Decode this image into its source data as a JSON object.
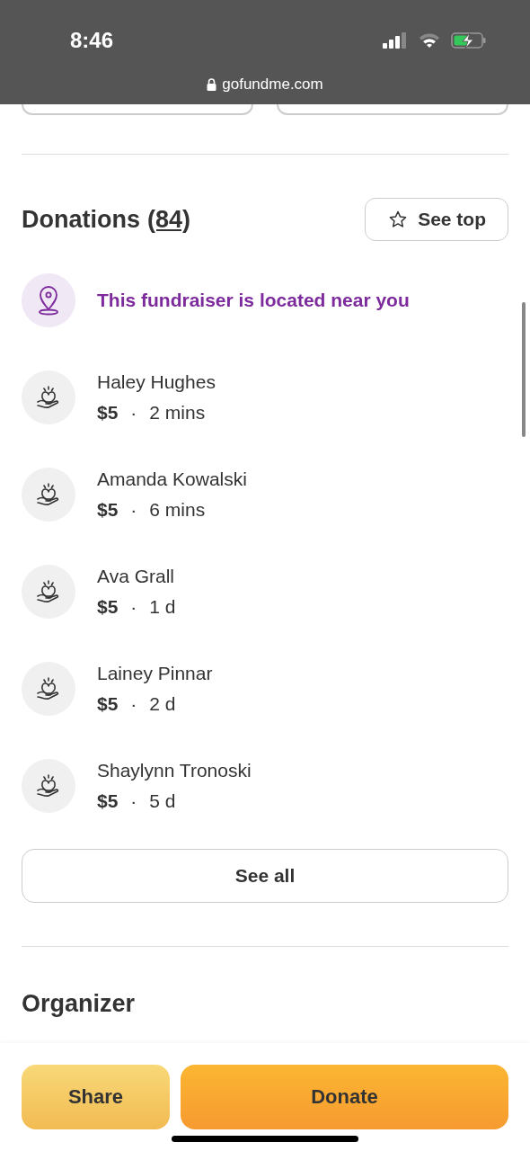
{
  "status_bar": {
    "time": "8:46",
    "url": "gofundme.com"
  },
  "donations": {
    "title": "Donations",
    "count": "(84)",
    "see_top": "See top",
    "location_note": "This fundraiser is located near you",
    "donors": [
      {
        "name": "Haley Hughes",
        "amount": "$5",
        "time": "2 mins"
      },
      {
        "name": "Amanda Kowalski",
        "amount": "$5",
        "time": "6 mins"
      },
      {
        "name": "Ava Grall",
        "amount": "$5",
        "time": "1 d"
      },
      {
        "name": "Lainey Pinnar",
        "amount": "$5",
        "time": "2 d"
      },
      {
        "name": "Shaylynn Tronoski",
        "amount": "$5",
        "time": "5 d"
      }
    ],
    "separator": "·",
    "see_all": "See all"
  },
  "organizer": {
    "title": "Organizer"
  },
  "bottom_bar": {
    "buttons": [
      {
        "label": "Share",
        "kind": "secondary"
      },
      {
        "label": "Donate",
        "kind": "primary"
      }
    ]
  }
}
